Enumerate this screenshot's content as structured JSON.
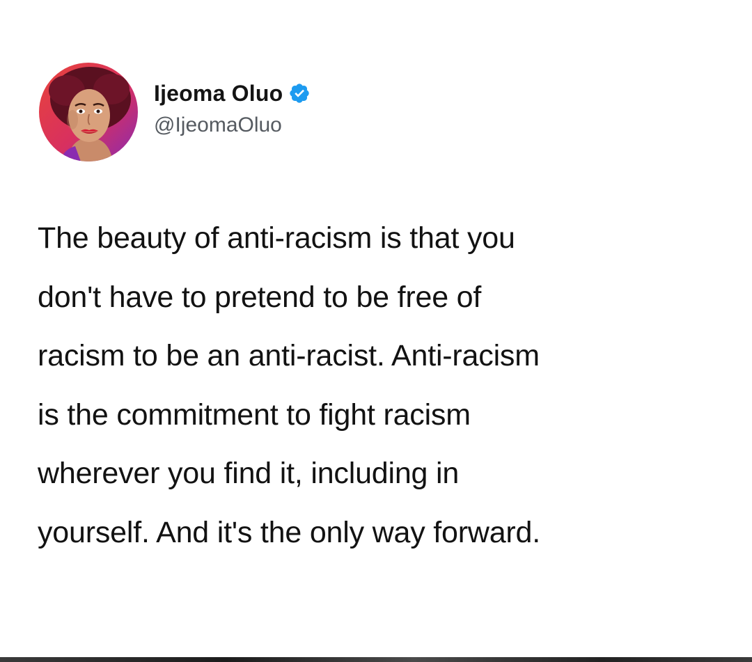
{
  "tweet": {
    "author": {
      "display_name": "Ijeoma Oluo",
      "handle": "@IjeomaOluo",
      "verified": true
    },
    "text": "The beauty of anti-racism is that you\ndon't have to pretend to be free of\nracism to be an anti-racist. Anti-racism\nis the commitment to fight racism\nwherever you find it, including in\nyourself. And it's the only way forward."
  },
  "icons": {
    "verified": "verified-badge-icon",
    "avatar": "profile-photo"
  },
  "colors": {
    "verified_blue": "#1d9bf0",
    "text": "#121212",
    "handle": "#555a60",
    "background": "#ffffff"
  }
}
